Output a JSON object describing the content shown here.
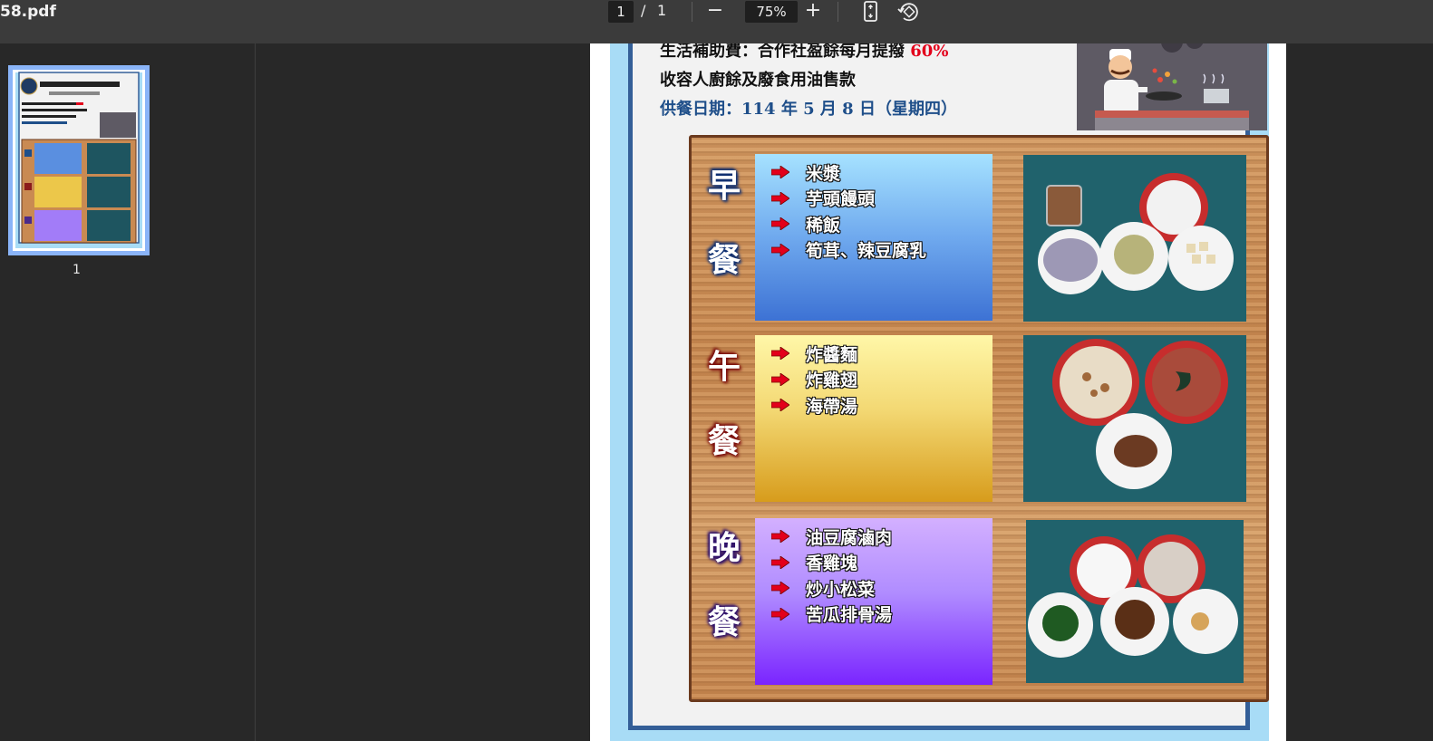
{
  "toolbar": {
    "filename": "58.pdf",
    "page_current": "1",
    "page_separator": "/",
    "page_total": "1",
    "zoom_out": "−",
    "zoom_level": "75%",
    "zoom_in": "+"
  },
  "sidebar": {
    "thumbnail_label": "1"
  },
  "document": {
    "header": {
      "line1_text": "生活補助費：合作社盈餘每月提撥",
      "line1_percent": "60%",
      "line2": "收容人廚餘及廢食用油售款",
      "date_line": "供餐日期：114 年 5 月 8 日（星期四）"
    },
    "meals": [
      {
        "label_top": "早",
        "label_bottom": "餐",
        "items": [
          "米漿",
          "芋頭饅頭",
          "稀飯",
          "筍茸、辣豆腐乳"
        ]
      },
      {
        "label_top": "午",
        "label_bottom": "餐",
        "items": [
          "炸醬麵",
          "炸雞翅",
          "海帶湯"
        ]
      },
      {
        "label_top": "晚",
        "label_bottom": "餐",
        "items": [
          "油豆腐滷肉",
          "香雞塊",
          "炒小松菜",
          "苦瓜排骨湯"
        ]
      }
    ]
  },
  "colors": {
    "toolbar_bg": "#3b3b3b",
    "viewer_bg": "#282828",
    "page_border_blue": "#345f98",
    "outer_light_blue": "#a8dcf6",
    "red_accent": "#e3001b",
    "date_blue": "#1f4f8a",
    "thumb_highlight": "#8ab4f8"
  }
}
